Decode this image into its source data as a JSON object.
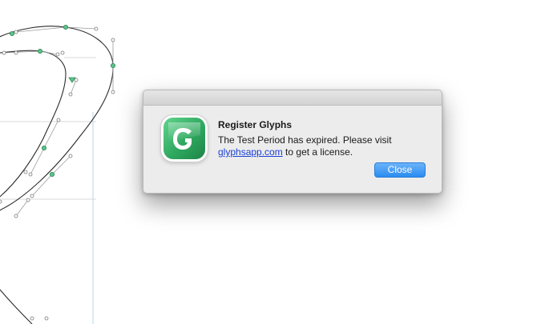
{
  "dialog": {
    "title": "Register Glyphs",
    "message_before": "The Test Period has expired. Please visit",
    "link_text": "glyphsapp.com",
    "message_after": " to get a license.",
    "close_label": "Close"
  },
  "icon": {
    "name": "glyphs-app-icon",
    "color": "#3bb56c"
  },
  "colors": {
    "button": "#3a97f5",
    "link": "#1a3fd6",
    "node": "#3fa56b"
  }
}
